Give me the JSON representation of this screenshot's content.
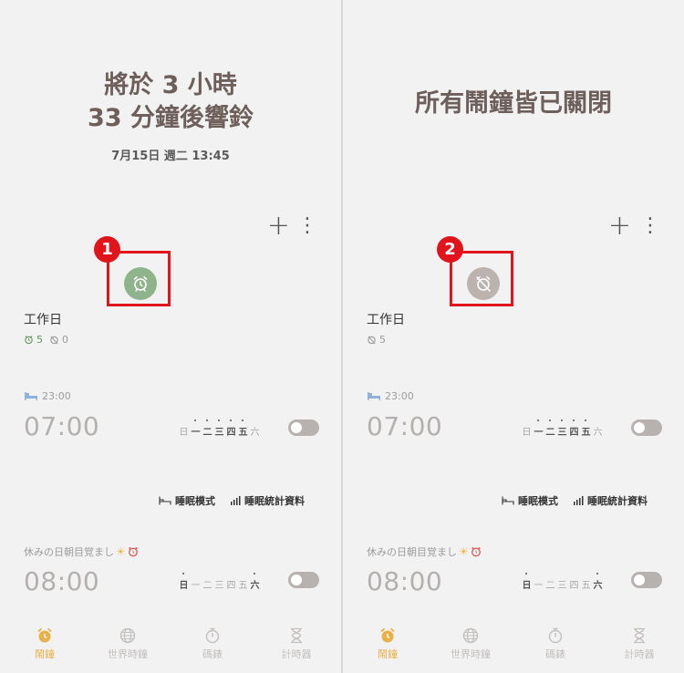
{
  "left": {
    "headline_line1": "將於 3 小時",
    "headline_line2": "33 分鐘後響鈴",
    "date": "7月15日 週二 13:45",
    "badge": "1",
    "group_name": "工作日",
    "count_on": "5",
    "count_off": "0"
  },
  "right": {
    "headline": "所有鬧鐘皆已關閉",
    "badge": "2",
    "group_name": "工作日",
    "count_off": "5"
  },
  "toolbar": {
    "add": "+",
    "more": "⋮"
  },
  "alarm1": {
    "bedtime": "23:00",
    "time": "07:00",
    "days": [
      "日",
      "一",
      "二",
      "三",
      "四",
      "五",
      "六"
    ],
    "active_days": [
      1,
      2,
      3,
      4,
      5
    ]
  },
  "sleep_links": {
    "sleep_mode": "睡眠模式",
    "sleep_stats": "睡眠統計資料"
  },
  "alarm2": {
    "label": "休みの日朝目覚まし",
    "time": "08:00",
    "days": [
      "日",
      "一",
      "二",
      "三",
      "四",
      "五",
      "六"
    ],
    "active_days": [
      0,
      6
    ]
  },
  "nav": {
    "alarm": "鬧鐘",
    "world_clock": "世界時鐘",
    "stopwatch": "碼錶",
    "timer": "計時器"
  },
  "colors": {
    "accent": "#e8b14a",
    "highlight": "#e0141a",
    "enabled_icon": "#8fb48c",
    "disabled_icon": "#bcb2ae"
  }
}
